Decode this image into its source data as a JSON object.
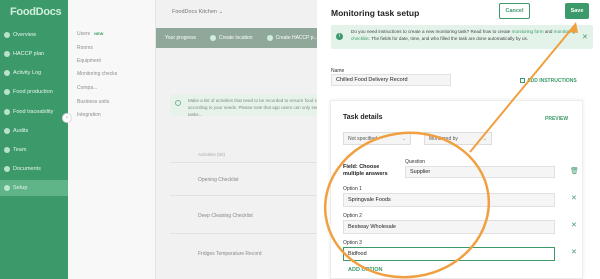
{
  "app": {
    "logo": "FoodDocs"
  },
  "sidebar": {
    "items": [
      {
        "label": "Overview"
      },
      {
        "label": "HACCP plan"
      },
      {
        "label": "Activity Log"
      },
      {
        "label": "Food production"
      },
      {
        "label": "Food traceability"
      },
      {
        "label": "Audits"
      },
      {
        "label": "Team"
      },
      {
        "label": "Documents"
      },
      {
        "label": "Setup"
      }
    ],
    "active": "Setup"
  },
  "subnav": {
    "items": [
      {
        "label": "Users",
        "badge": "NEW"
      },
      {
        "label": "Rooms"
      },
      {
        "label": "Equipment"
      },
      {
        "label": "Monitoring checks"
      },
      {
        "label": "Compa..."
      },
      {
        "label": "Business units"
      },
      {
        "label": "Integration"
      }
    ],
    "collapse": "‹"
  },
  "main": {
    "location": "FoodDocs Kitchen",
    "location_chevron": "⌄",
    "progress": {
      "label": "Your progress",
      "steps": [
        "Create location",
        "Create HACCP p..."
      ]
    },
    "tip": "Make a list of activities that need to be recorded to ensure food safety according to your needs. Please note that app users can only see these tasks...",
    "activities_header": "Activities (50)",
    "activities": [
      "Opening Checklist",
      "Deep Cleaning Checklist",
      "Fridges Temperature Record"
    ]
  },
  "panel": {
    "title": "Monitoring task setup",
    "cancel": "Cancel",
    "save": "Save",
    "info": {
      "icon": "i",
      "text_1": "Do you need instructions to create a new monitoring task? Read how to create ",
      "link_1": "monitoring form",
      "text_2": " and ",
      "link_2": "monitoring checklist",
      "text_3": ". The fields for date, time, and who filled the task are done automatically by us.",
      "close": "✕"
    },
    "name_label": "Name",
    "name_value": "Chilled Food Delivery Record",
    "add_instructions": "ADD INSTRUCTIONS"
  },
  "task": {
    "title": "Task details",
    "preview": "PREVIEW",
    "select_1": "Not specified",
    "select_2": "Monitored by",
    "chevron": "⌄",
    "field_label": "Field: Choose multiple answers",
    "question_label": "Question",
    "question_value": "Supplier",
    "trash_icon": "🗑",
    "remove_icon": "✕",
    "options": [
      {
        "label": "Option 1",
        "value": "Springvale Foods"
      },
      {
        "label": "Option 2",
        "value": "Bestway Wholesale"
      },
      {
        "label": "Option 3",
        "value": "Bidfood"
      }
    ],
    "add_option": "ADD OPTION"
  },
  "colors": {
    "brand": "#3c9a6a",
    "annotation": "#f0a040"
  }
}
